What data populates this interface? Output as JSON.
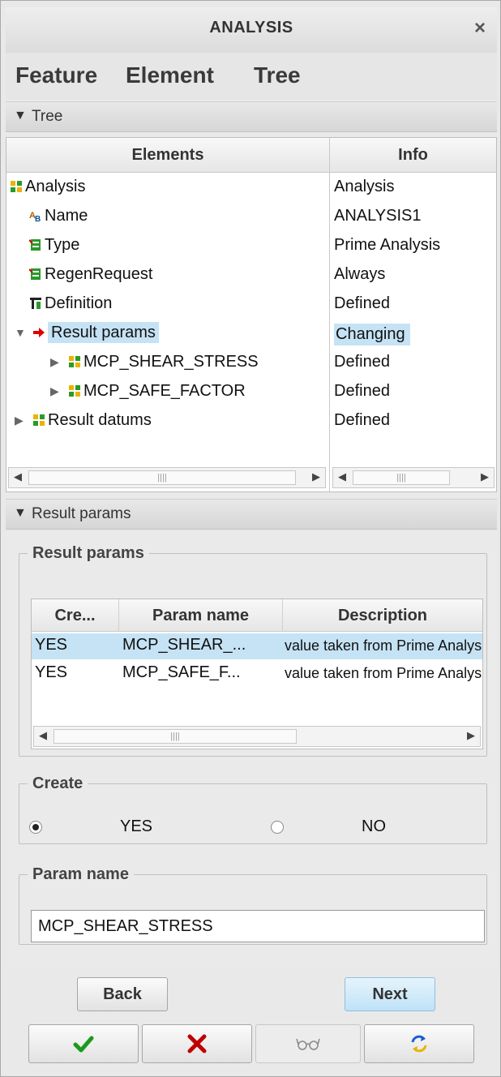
{
  "window": {
    "title": "ANALYSIS",
    "close_glyph": "×"
  },
  "menu": {
    "items": [
      "Feature",
      "Element",
      "Tree"
    ]
  },
  "tree_section": {
    "label": "Tree"
  },
  "tree": {
    "headers": {
      "elements": "Elements",
      "info": "Info"
    },
    "rows": [
      {
        "label": "Analysis",
        "info": "Analysis",
        "icon": "feature-icon"
      },
      {
        "label": "Name",
        "info": "ANALYSIS1",
        "icon": "text-icon"
      },
      {
        "label": "Type",
        "info": "Prime Analysis",
        "icon": "option-icon"
      },
      {
        "label": "RegenRequest",
        "info": "Always",
        "icon": "option-icon"
      },
      {
        "label": "Definition",
        "info": "Defined",
        "icon": "definition-icon"
      },
      {
        "label": "Result params",
        "info": "Changing",
        "icon": "arrow-icon"
      },
      {
        "label": "MCP_SHEAR_STRESS",
        "info": "Defined",
        "icon": "param-icon"
      },
      {
        "label": "MCP_SAFE_FACTOR",
        "info": "Defined",
        "icon": "param-icon"
      },
      {
        "label": "Result datums",
        "info": "Defined",
        "icon": "param-icon"
      }
    ]
  },
  "params_section": {
    "label": "Result params"
  },
  "result_params": {
    "legend": "Result params",
    "headers": [
      "Cre...",
      "Param name",
      "Description"
    ],
    "rows": [
      {
        "create": "YES",
        "name": "MCP_SHEAR_...",
        "desc": "value taken from Prime Analysis"
      },
      {
        "create": "YES",
        "name": "MCP_SAFE_F...",
        "desc": "value taken from Prime Analysis"
      }
    ]
  },
  "create": {
    "legend": "Create",
    "yes": "YES",
    "no": "NO",
    "selected": "YES"
  },
  "param_name": {
    "legend": "Param name",
    "value": "MCP_SHEAR_STRESS"
  },
  "buttons": {
    "back": "Back",
    "next": "Next"
  },
  "toolbar": {
    "ok": "checkmark-icon",
    "cancel": "x-icon",
    "preview": "glasses-icon",
    "repaint": "refresh-icon"
  },
  "colors": {
    "selection": "#c5e3f5",
    "accent_arrow": "#e00000",
    "ok_green": "#1a9a1a",
    "cancel_red": "#c00000"
  }
}
